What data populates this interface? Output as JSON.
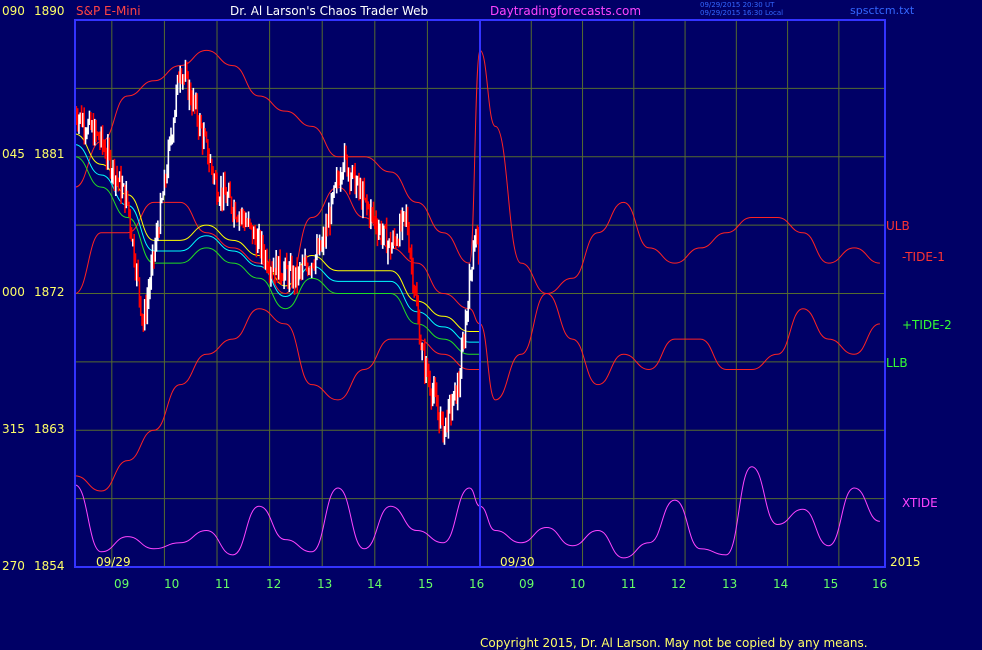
{
  "header": {
    "instrument": "S&P E-Mini",
    "site_title": "Dr. Al Larson's Chaos Trader Web",
    "site_url": "Daytradingforecasts.com",
    "timestamp_utc": "09/29/2015 20:30 UT",
    "timestamp_local": "09/29/2015 16:30 Local",
    "file_name": "spsctcm.txt"
  },
  "footer": {
    "copyright": "Copyright 2015, Dr. Al Larson. May not be copied by any means."
  },
  "colors": {
    "background": "#000066",
    "frame": "#3333ff",
    "grid": "#556b2f",
    "price_up": "#ffffff",
    "price_down": "#ff0000",
    "yellow_line": "#ffff00",
    "cyan_line": "#00ffff",
    "bands": "#ff2222",
    "tide": "#22dd22",
    "xtide": "#ff44ff",
    "header_red": "#ff4444",
    "header_magenta": "#ff44ff",
    "header_blue": "#3366ff"
  },
  "chart_data": {
    "type": "line",
    "title": "S&P E-Mini",
    "y_axis": {
      "price_labels": [
        "1890",
        "1881",
        "1872",
        "1863",
        "1854"
      ],
      "osc_labels": [
        "090",
        "045",
        "000",
        "315",
        "270"
      ],
      "ylim": [
        1854,
        1890
      ]
    },
    "x_axis": {
      "hour_labels": [
        "09",
        "10",
        "11",
        "12",
        "13",
        "14",
        "15",
        "16",
        "09",
        "10",
        "11",
        "12",
        "13",
        "14",
        "15",
        "16"
      ],
      "date_labels": [
        "09/29",
        "09/30"
      ],
      "year_label": "2015",
      "sessions": 2,
      "hours_per_session": 8
    },
    "series_labels": [
      "ULB",
      "-TIDE-1",
      "+TIDE-2",
      "LLB",
      "XTIDE"
    ],
    "series": [
      {
        "name": "ULB",
        "role": "upper band",
        "x_hours": [
          8.3,
          8.8,
          9.3,
          9.8,
          10.3,
          10.8,
          11.3,
          11.8,
          12.3,
          12.8,
          13.3,
          13.8,
          14.3,
          14.8,
          15.3,
          15.8,
          16.0,
          16.3,
          16.8,
          17.3,
          17.8,
          18.3,
          18.8,
          19.3,
          19.8,
          20.3,
          20.8,
          21.3,
          21.8,
          22.3,
          22.8,
          23.3,
          23.8
        ],
        "values": [
          1879,
          1882,
          1885,
          1886,
          1887,
          1888,
          1887,
          1885,
          1884,
          1883,
          1881,
          1881,
          1880,
          1878,
          1876,
          1874,
          1888,
          1883,
          1874,
          1872,
          1873,
          1876,
          1878,
          1875,
          1874,
          1875,
          1876,
          1877,
          1877,
          1876,
          1874,
          1875,
          1874
        ]
      },
      {
        "name": "LLB",
        "role": "lower band",
        "x_hours": [
          8.3,
          8.8,
          9.3,
          9.8,
          10.3,
          10.8,
          11.3,
          11.8,
          12.3,
          12.8,
          13.3,
          13.8,
          14.3,
          14.8,
          15.3,
          15.8,
          16.0
        ],
        "values": [
          1860,
          1859,
          1861,
          1863,
          1866,
          1868,
          1869,
          1871,
          1870,
          1866,
          1865,
          1867,
          1869,
          1869,
          1868,
          1867,
          1867
        ]
      },
      {
        "name": "-TIDE-1",
        "role": "tide",
        "x_hours": [
          8.3,
          8.8,
          9.3,
          9.8,
          10.3,
          10.8,
          11.3,
          11.8,
          12.3,
          12.8,
          13.3,
          13.8,
          14.3,
          14.8,
          15.3,
          15.8,
          16.0,
          16.3,
          16.8,
          17.3,
          17.8,
          18.3,
          18.8,
          19.3,
          19.8,
          20.3,
          20.8,
          21.3,
          21.8,
          22.3,
          22.8,
          23.3,
          23.8
        ],
        "values": [
          1872,
          1876,
          1876,
          1878,
          1878,
          1876,
          1875,
          1874,
          1872,
          1877,
          1879,
          1877,
          1875,
          1874,
          1872,
          1871,
          1870,
          1865,
          1868,
          1872,
          1869,
          1866,
          1868,
          1867,
          1869,
          1869,
          1867,
          1867,
          1868,
          1871,
          1869,
          1868,
          1870
        ]
      },
      {
        "name": "+TIDE-2",
        "role": "tide",
        "x_hours": [
          8.3,
          8.8,
          9.3,
          9.8,
          10.3,
          10.8,
          11.3,
          11.8,
          12.3,
          12.8,
          13.3,
          13.8,
          14.3,
          14.8,
          15.3,
          15.8,
          16.0
        ],
        "values": [
          1881,
          1879,
          1877,
          1874,
          1874,
          1875,
          1874,
          1873,
          1871,
          1873,
          1872,
          1872,
          1872,
          1870,
          1869,
          1868,
          1868
        ]
      },
      {
        "name": "XTIDE",
        "role": "oscillator",
        "x_hours": [
          8.3,
          8.8,
          9.3,
          9.8,
          10.3,
          10.8,
          11.3,
          11.8,
          12.3,
          12.8,
          13.3,
          13.8,
          14.3,
          14.8,
          15.3,
          15.8,
          16.0,
          16.3,
          16.8,
          17.3,
          17.8,
          18.3,
          18.8,
          19.3,
          19.8,
          20.3,
          20.8,
          21.3,
          21.8,
          22.3,
          22.8,
          23.3,
          23.8
        ],
        "values": [
          297,
          275,
          280,
          276,
          278,
          282,
          274,
          290,
          279,
          275,
          296,
          276,
          290,
          282,
          278,
          296,
          290,
          282,
          278,
          283,
          277,
          282,
          273,
          278,
          292,
          276,
          274,
          303,
          284,
          289,
          277,
          296,
          285
        ]
      }
    ]
  }
}
